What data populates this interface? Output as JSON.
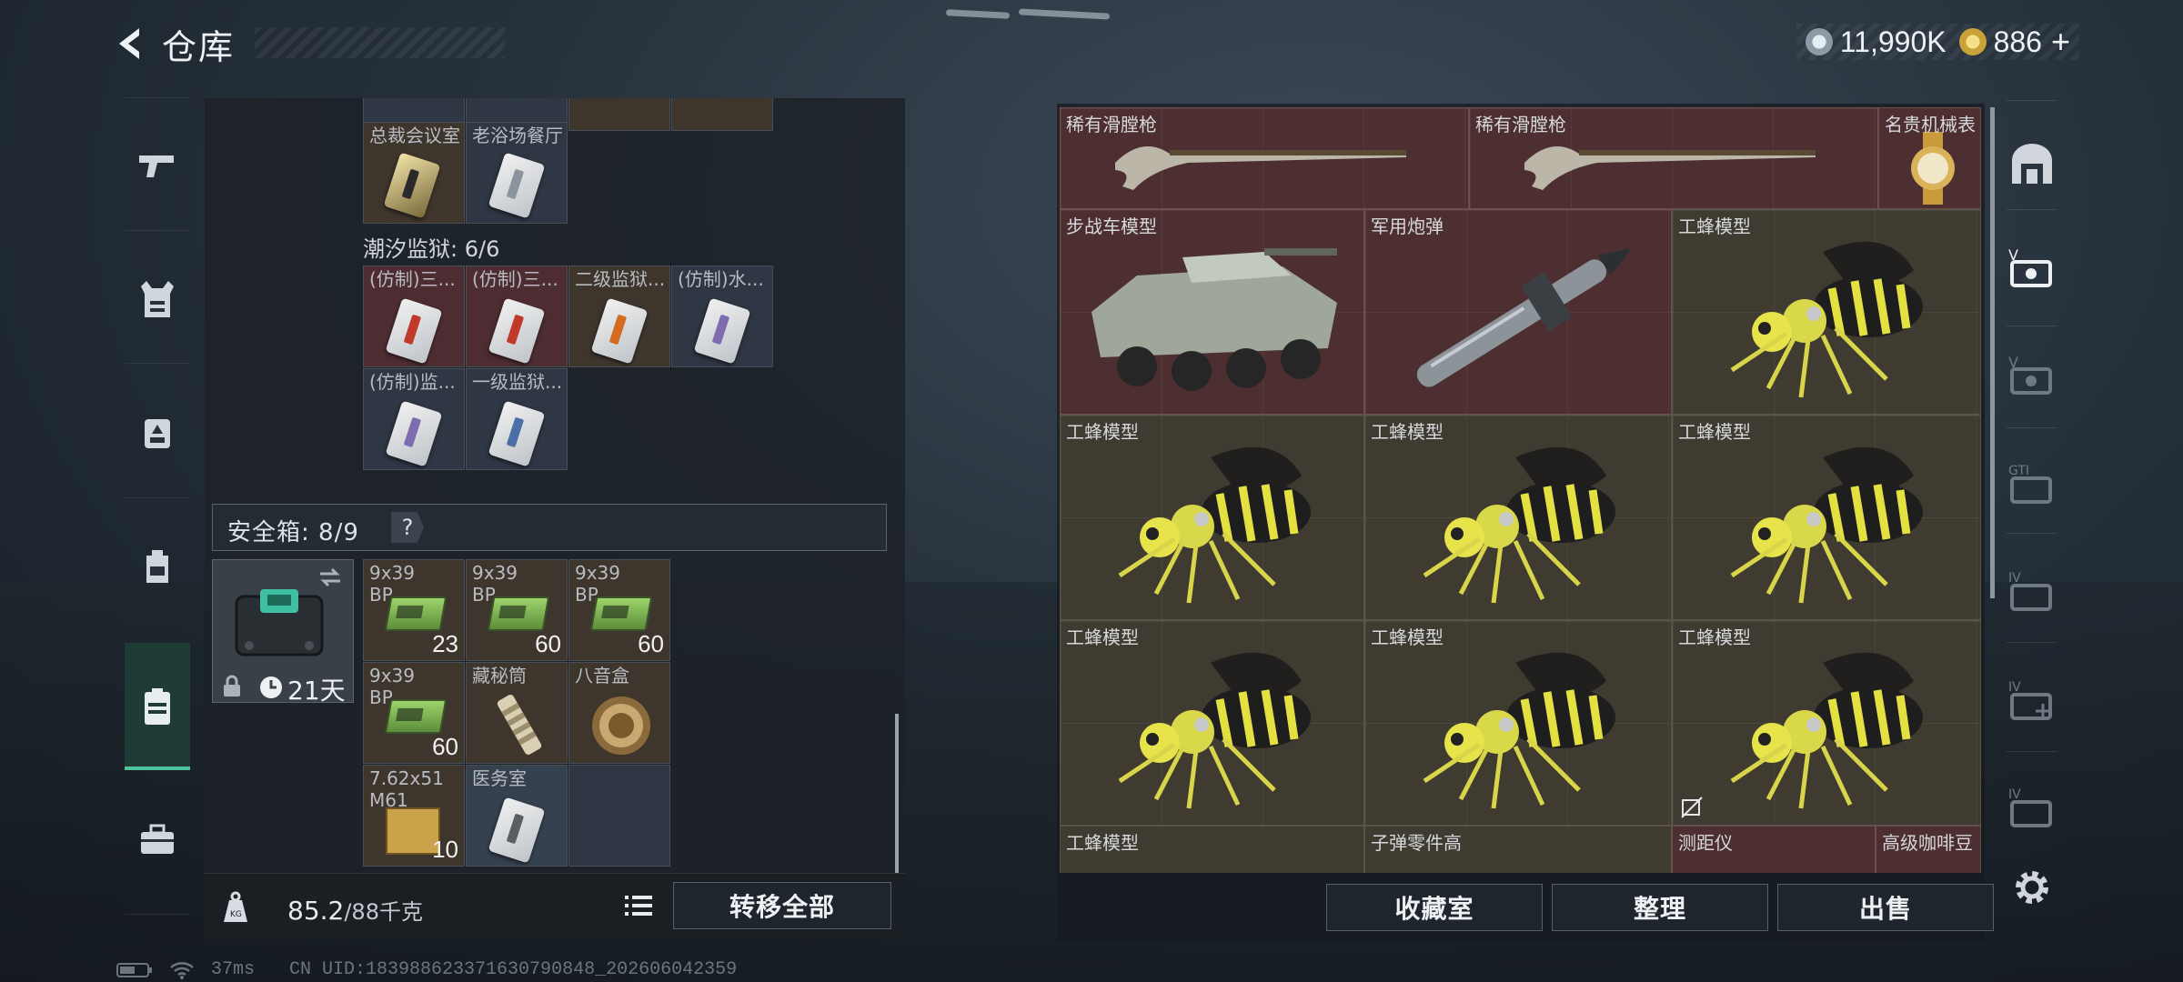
{
  "header": {
    "title": "仓库"
  },
  "currency": [
    {
      "name": "coin-silver-icon",
      "value": "11,990K",
      "color": "#b9c4ce"
    },
    {
      "name": "coin-gold-icon",
      "value": "886",
      "color": "#c9a23a"
    }
  ],
  "left_nav": [
    "gun-icon",
    "armor-vest-icon",
    "chest-rig-icon",
    "backpack-icon",
    "case-icon",
    "toolbox-icon"
  ],
  "left_top_cells": [
    {
      "label": "总裁会议室",
      "count": "",
      "color": "gold"
    },
    {
      "label": "老浴场餐厅",
      "count": "",
      "color": "silver"
    }
  ],
  "tide_prison": {
    "title": "潮汐监狱: 6/6"
  },
  "prison_cells": [
    {
      "label": "(仿制)三...",
      "color": "red"
    },
    {
      "label": "(仿制)三...",
      "color": "red"
    },
    {
      "label": "二级监狱...",
      "color": "orange"
    },
    {
      "label": "(仿制)水...",
      "color": "purple"
    },
    {
      "label": "(仿制)监...",
      "color": "purple"
    },
    {
      "label": "一级监狱...",
      "color": "blue"
    }
  ],
  "safe": {
    "label": "安全箱: 8/9",
    "help": "?",
    "days": "21天"
  },
  "safe_cells": [
    {
      "label": "9x39\nBP",
      "count": "23"
    },
    {
      "label": "9x39\nBP",
      "count": "60"
    },
    {
      "label": "9x39\nBP",
      "count": "60"
    },
    {
      "label": "9x39\nBP",
      "count": "60"
    },
    {
      "label": "藏秘筒",
      "count": ""
    },
    {
      "label": "八音盒",
      "count": ""
    },
    {
      "label": "7.62x51\nM61",
      "count": "10"
    },
    {
      "label": "医务室",
      "count": ""
    }
  ],
  "weight": {
    "current": "85.2",
    "max": "/88千克"
  },
  "buttons": {
    "transfer_all": "转移全部",
    "collection": "收藏室",
    "sort": "整理",
    "sell": "出售"
  },
  "right_items": [
    {
      "label": "稀有滑膛枪"
    },
    {
      "label": "稀有滑膛枪"
    },
    {
      "label": "名贵机械表"
    },
    {
      "label": "步战车模型"
    },
    {
      "label": "军用炮弹"
    },
    {
      "label": "工蜂模型"
    },
    {
      "label": "工蜂模型"
    },
    {
      "label": "工蜂模型"
    },
    {
      "label": "工蜂模型"
    },
    {
      "label": "工蜂模型"
    },
    {
      "label": "工蜂模型"
    },
    {
      "label": "工蜂模型"
    },
    {
      "label": "工蜂模型"
    },
    {
      "label": "子弹零件高"
    },
    {
      "label": "测距仪"
    },
    {
      "label": "高级咖啡豆"
    }
  ],
  "right_nav": [
    "stash-home-icon",
    "stash-v-icon",
    "stash-v2-icon",
    "stash-gti-icon",
    "stash-iv-icon",
    "stash-iv-add-icon",
    "stash-iv-3-icon",
    "settings-icon"
  ],
  "status": {
    "ping": "37ms",
    "uid": "CN UID:1839886233716307908​48_202606042359"
  }
}
